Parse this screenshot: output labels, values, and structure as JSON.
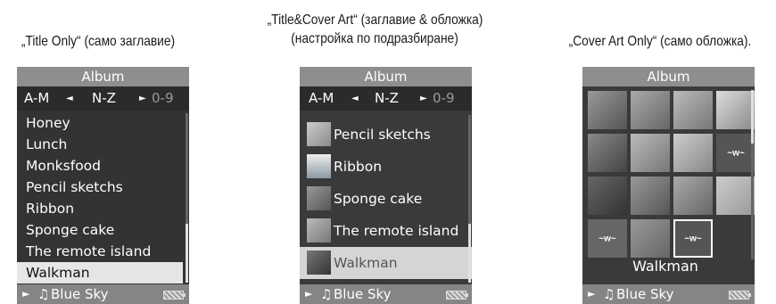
{
  "captions": {
    "title_only": "„Title Only“ (само заглавие)",
    "title_cover_line1": "„Title&Cover Art“ (заглавие & обложка)",
    "title_cover_line2": "(настройка по подразбиране)",
    "cover_only": "„Cover Art Only“ (само обложка)."
  },
  "album_header": "Album",
  "tabs": {
    "am": "A-M",
    "nz": "N-Z",
    "09": "0-9"
  },
  "icons": {
    "prev_tab": "triangle-left-icon",
    "next_tab": "triangle-right-icon",
    "play": "play-icon",
    "note": "music-note-icon",
    "battery": "battery-icon"
  },
  "screen1_items": [
    "Honey",
    "Lunch",
    "Monksfood",
    "Pencil sketchs",
    "Ribbon",
    "Sponge cake",
    "The remote island",
    "Walkman"
  ],
  "screen2_items": [
    "Pencil sketchs",
    "Ribbon",
    "Sponge cake",
    "The remote island",
    "Walkman"
  ],
  "screen3_selected_label": "Walkman",
  "now_playing": "Blue Sky",
  "colors": {
    "title_bar": "#8e8e8e",
    "screen_bg": "#333333",
    "selected_row": "#e6e6e6"
  }
}
